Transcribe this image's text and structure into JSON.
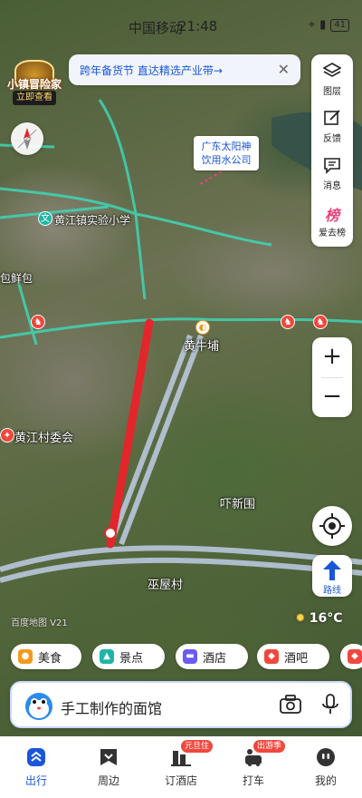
{
  "status_bar": {
    "carrier": "中国移动",
    "time": "21:48",
    "battery": "41"
  },
  "banner": {
    "text": "跨年备货节 直达精选产业带→",
    "close": "✕"
  },
  "promo": {
    "title": "小镇冒险家",
    "cta": "立即查看"
  },
  "right_tools": [
    {
      "icon": "layers-icon",
      "label": "图层"
    },
    {
      "icon": "feedback-icon",
      "label": "反馈"
    },
    {
      "icon": "message-icon",
      "label": "消息"
    },
    {
      "icon": "bang-icon",
      "glyph": "榜",
      "label": "爱去榜"
    }
  ],
  "zoom": {
    "in": "+",
    "out": "−"
  },
  "route_button": {
    "label": "路线"
  },
  "weather": {
    "temp": "16°C",
    "icon": "sun-icon"
  },
  "map_logo": "百度地图 V21",
  "map_labels": {
    "callout": "广东太阳神饮用水公司",
    "school": "黄江镇实验小学",
    "bun": "包鲜包",
    "station": "黄牛埔",
    "village_committee": "黄江村委会",
    "xinwei": "吓新围",
    "wuwu": "巫屋村"
  },
  "chips": [
    {
      "label": "美食",
      "icon": "food-icon",
      "color": "#f39a1e"
    },
    {
      "label": "景点",
      "icon": "scenic-icon",
      "color": "#1fb6a6"
    },
    {
      "label": "酒店",
      "icon": "hotel-icon",
      "color": "#6a5cf0"
    },
    {
      "label": "酒吧",
      "icon": "bar-icon",
      "color": "#f0483e"
    }
  ],
  "search": {
    "text": "手工制作的面馆"
  },
  "bottom_nav": [
    {
      "label": "出行",
      "icon": "travel-icon",
      "active": true
    },
    {
      "label": "周边",
      "icon": "nearby-icon"
    },
    {
      "label": "订酒店",
      "icon": "hotel-booking-icon",
      "badge": "元旦住"
    },
    {
      "label": "打车",
      "icon": "taxi-icon",
      "badge": "出游季"
    },
    {
      "label": "我的",
      "icon": "profile-icon"
    }
  ],
  "colors": {
    "accent": "#1a56d8",
    "route_red": "#e3262b",
    "road_teal": "#3fd6b6",
    "badge_red": "#f0483e"
  }
}
